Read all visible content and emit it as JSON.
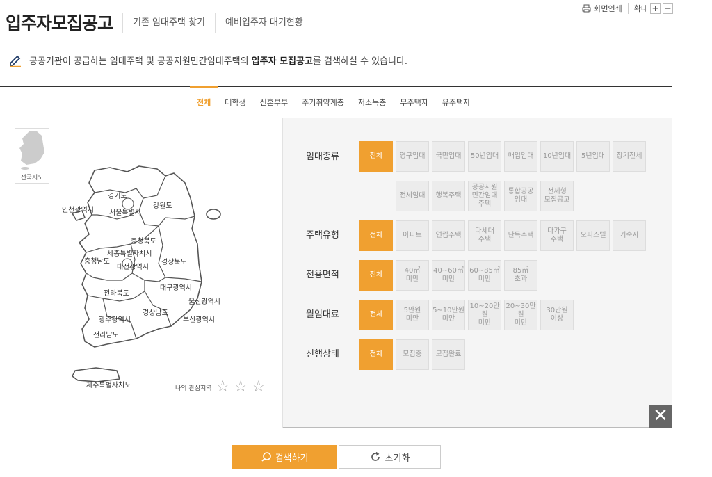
{
  "header": {
    "title": "입주자모집공고",
    "tabs": [
      "기존 임대주택 찾기",
      "예비입주자 대기현황"
    ],
    "print_label": "화면인쇄",
    "zoom_label": "확대",
    "zoom_in": "+",
    "zoom_out": "−"
  },
  "description": {
    "prefix": "공공기관이 공급하는 임대주택 및 공공지원민간임대주택의 ",
    "highlight": "입주자 모집공고",
    "suffix": "를 검색하실 수 있습니다."
  },
  "category_tabs": [
    "전체",
    "대학생",
    "신혼부부",
    "주거취약계층",
    "저소득층",
    "무주택자",
    "유주택자"
  ],
  "map": {
    "mini_label": "전국지도",
    "regions": [
      "경기도",
      "인천광역시",
      "서울특별시",
      "강원도",
      "충청북도",
      "세종특별자치시",
      "충청남도",
      "대전광역시",
      "경상북도",
      "전라북도",
      "대구광역시",
      "울산광역시",
      "경상남도",
      "광주광역시",
      "부산광역시",
      "전라남도",
      "제주특별자치도"
    ],
    "favorite_label": "나의 관심지역"
  },
  "filters": {
    "rental_type": {
      "label": "임대종류",
      "options": [
        "전체",
        "영구임대",
        "국민임대",
        "50년임대",
        "매입임대",
        "10년임대",
        "5년임대",
        "장기전세",
        "전세임대",
        "행복주택",
        "공공지원\n민간임대\n주택",
        "통합공공\n임대",
        "전세형\n모집공고"
      ]
    },
    "housing_type": {
      "label": "주택유형",
      "options": [
        "전체",
        "아파트",
        "연립주택",
        "다세대\n주택",
        "단독주택",
        "다가구\n주택",
        "오피스텔",
        "기숙사"
      ]
    },
    "area": {
      "label": "전용면적",
      "options": [
        "전체",
        "40㎡\n미만",
        "40~60㎡\n미만",
        "60~85㎡\n미만",
        "85㎡\n초과"
      ]
    },
    "rent": {
      "label": "월임대료",
      "options": [
        "전체",
        "5만원\n미만",
        "5~10만원\n미만",
        "10~20만원\n미만",
        "20~30만원\n미만",
        "30만원\n이상"
      ]
    },
    "status": {
      "label": "진행상태",
      "options": [
        "전체",
        "모집중",
        "모집완료"
      ]
    }
  },
  "buttons": {
    "search": "검색하기",
    "reset": "초기화"
  },
  "colors": {
    "accent": "#f0a030",
    "close_bg": "#666666"
  }
}
